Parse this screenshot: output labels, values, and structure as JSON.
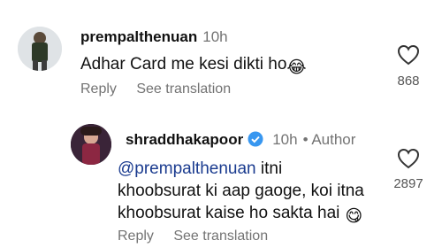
{
  "comments": [
    {
      "username": "prempalthenuan",
      "time": "10h",
      "text": "Adhar Card me kesi dikti ho",
      "emoji": "😂",
      "reply_label": "Reply",
      "translate_label": "See translation",
      "likes": "868",
      "icon": "heart-outline-icon"
    },
    {
      "username": "shraddhakapoor",
      "time": "10h",
      "author_label": "• Author",
      "mention": "@prempalthenuan",
      "text_line1": " itni",
      "text_line2": "khoobsurat ki aap gaoge, koi itna",
      "text_line3": "khoobsurat kaise ho sakta hai",
      "emoji": "😋",
      "reply_label": "Reply",
      "translate_label": "See translation",
      "likes": "2897",
      "verified_color": "#3897f0",
      "icon": "heart-outline-icon"
    }
  ]
}
